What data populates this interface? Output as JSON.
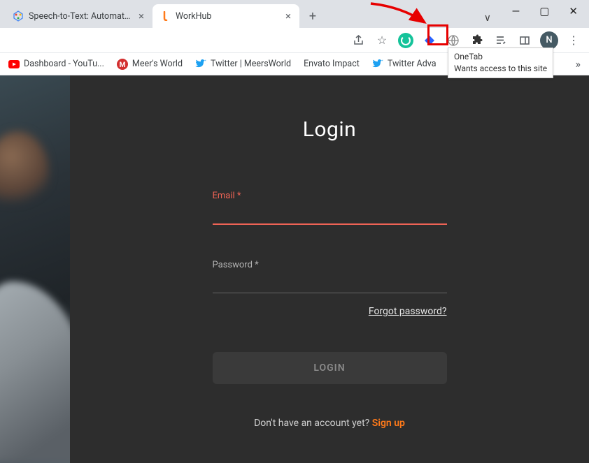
{
  "window": {
    "min": "—",
    "max": "▢",
    "close": "✕",
    "dropdown": "∨"
  },
  "tabs": {
    "items": [
      {
        "title": "Speech-to-Text: Automatic Spee",
        "icon": "gcloud"
      },
      {
        "title": "WorkHub",
        "icon": "workhub"
      }
    ],
    "new": "+"
  },
  "toolbar": {
    "share": "↗",
    "star": "☆",
    "globe": "⊕",
    "puzzle": "✦",
    "reading": "≡",
    "side": "◫",
    "avatar": "N",
    "menu": "⋮"
  },
  "tooltip": {
    "title": "OneTab",
    "body": "Wants access to this site"
  },
  "bookmarks": {
    "items": [
      {
        "icon": "yt",
        "label": "Dashboard - YouTu..."
      },
      {
        "icon": "m",
        "label": "Meer's World"
      },
      {
        "icon": "tw",
        "label": "Twitter | MeersWorld"
      },
      {
        "icon": "",
        "label": "Envato Impact"
      },
      {
        "icon": "tw",
        "label": "Twitter Adva"
      }
    ],
    "overflow": "»"
  },
  "login": {
    "title": "Login",
    "email_label": "Email *",
    "password_label": "Password *",
    "forgot": "Forgot password?",
    "button": "LOGIN",
    "signup_prompt": "Don't have an account yet? ",
    "signup_link": "Sign up"
  }
}
